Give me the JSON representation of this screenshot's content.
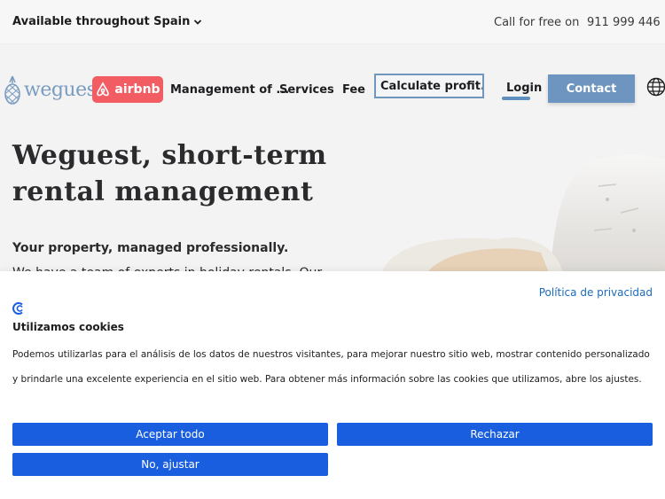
{
  "topbar": {
    "availability": "Available throughout Spain",
    "call_label": "Call for free on",
    "phone": "911 999 446"
  },
  "nav": {
    "logo_text": "weguest",
    "airbnb_label": "airbnb",
    "management": "Management of ...",
    "services": "Services",
    "fee": "Fee",
    "calculate": "Calculate profit...",
    "login": "Login",
    "contact": "Contact"
  },
  "hero": {
    "title": "Weguest, short-term rental management",
    "subtitle": "Your property, managed professionally.",
    "cut_text": "We have a team of experts in holiday rentals. Our"
  },
  "cookie": {
    "privacy_link": "Política de privacidad",
    "title": "Utilizamos cookies",
    "text": "Podemos utilizarlas para el análisis de los datos de nuestros visitantes, para mejorar nuestro sitio web, mostrar contenido personalizado y brindarle una excelente experiencia en el sitio web. Para obtener más información sobre las cookies que utilizamos, abre los ajustes.",
    "accept": "Aceptar todo",
    "reject": "Rechazar",
    "adjust": "No, ajustar"
  },
  "colors": {
    "brand": "#7a9cc0",
    "airbnb": "#f15d63",
    "cookie_button": "#1a5ee0",
    "contact_button": "#6d95bf"
  },
  "icons": [
    "chevron-down-icon",
    "pineapple-logo-icon",
    "airbnb-icon",
    "globe-icon",
    "cookie-consent-icon"
  ]
}
